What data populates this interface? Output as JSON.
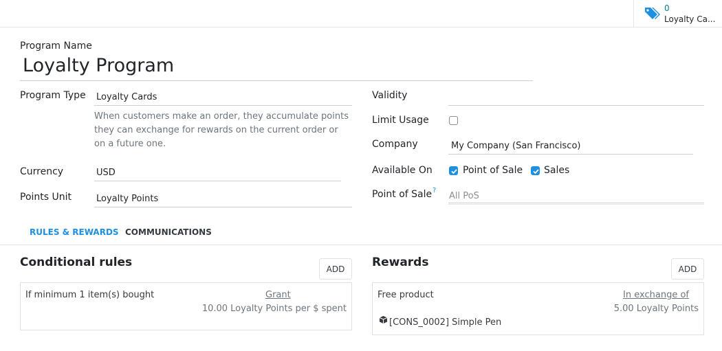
{
  "smart_button": {
    "count": "0",
    "label": "Loyalty Ca..."
  },
  "form": {
    "program_name_label": "Program Name",
    "program_name": "Loyalty Program",
    "program_type_label": "Program Type",
    "program_type_value": "Loyalty Cards",
    "program_type_description": "When customers make an order, they accumulate points they can exchange for rewards on the current order or on a future one.",
    "currency_label": "Currency",
    "currency_value": "USD",
    "points_unit_label": "Points Unit",
    "points_unit_value": "Loyalty Points",
    "validity_label": "Validity",
    "validity_value": "",
    "limit_usage_label": "Limit Usage",
    "company_label": "Company",
    "company_value": "My Company (San Francisco)",
    "available_on_label": "Available On",
    "available_on_options": [
      "Point of Sale",
      "Sales"
    ],
    "point_of_sale_label": "Point of Sale",
    "point_of_sale_help": "?",
    "point_of_sale_placeholder": "All PoS"
  },
  "tabs": [
    "RULES & REWARDS",
    "COMMUNICATIONS"
  ],
  "conditional_rules": {
    "title": "Conditional rules",
    "add_label": "ADD",
    "rule_condition": "If minimum 1 item(s) bought",
    "rule_action": "Grant",
    "rule_points": "10.00 Loyalty Points per $ spent"
  },
  "rewards": {
    "title": "Rewards",
    "add_label": "ADD",
    "reward_type": "Free product",
    "reward_action": "In exchange of",
    "reward_points": "5.00 Loyalty Points",
    "reward_product": "[CONS_0002] Simple Pen"
  },
  "colors": {
    "accent": "#1f8fe0",
    "teal": "#017e84",
    "border": "#dee2e6"
  }
}
